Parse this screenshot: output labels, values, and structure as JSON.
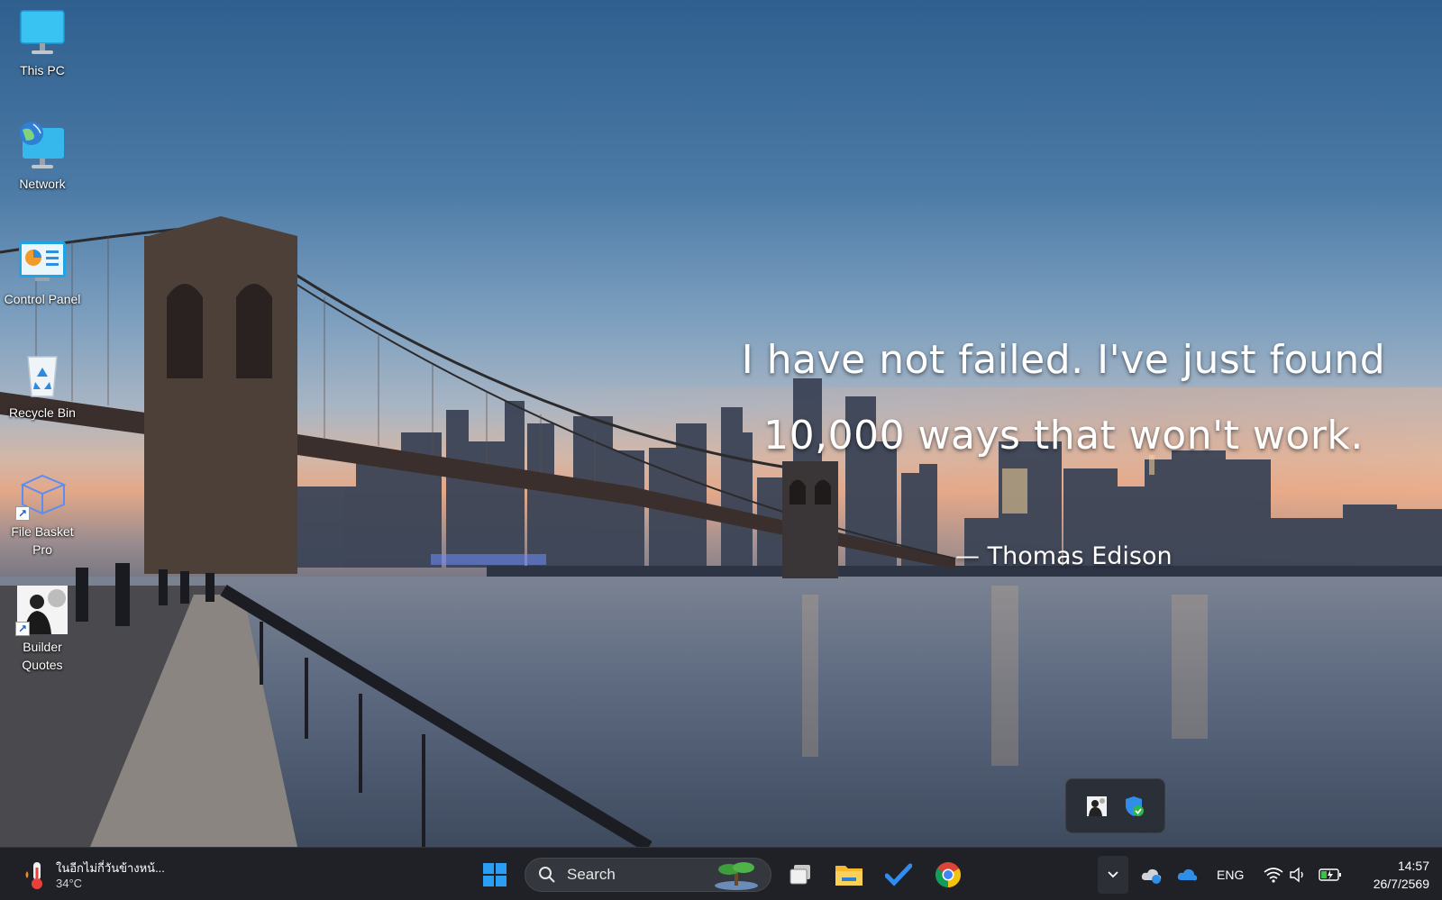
{
  "desktop": {
    "icons": [
      {
        "label": "This PC"
      },
      {
        "label": "Network"
      },
      {
        "label": "Control Panel"
      },
      {
        "label": "Recycle Bin"
      },
      {
        "label": "File Basket Pro"
      },
      {
        "label": "Builder Quotes"
      }
    ]
  },
  "wallpaper": {
    "quote": "I have not failed. I've just found 10,000 ways that won't work.",
    "author": "— Thomas Edison"
  },
  "tray_popup": {
    "icons": [
      "builder-quotes-tray-icon",
      "security-shield-icon"
    ]
  },
  "taskbar": {
    "weather": {
      "text": "ในอีกไม่กี่วันข้างหน้...",
      "temp": "34°C",
      "icon": "thermometer-icon"
    },
    "search_placeholder": "Search",
    "pinned": [
      "start-icon",
      "task-view-icon",
      "file-explorer-icon",
      "todo-icon",
      "chrome-icon"
    ],
    "tray": {
      "language": "ENG"
    },
    "clock": {
      "time": "14:57",
      "date": "26/7/2569"
    }
  },
  "colors": {
    "taskbar_bg": "#1f2127",
    "accent": "#1a8fe8"
  }
}
